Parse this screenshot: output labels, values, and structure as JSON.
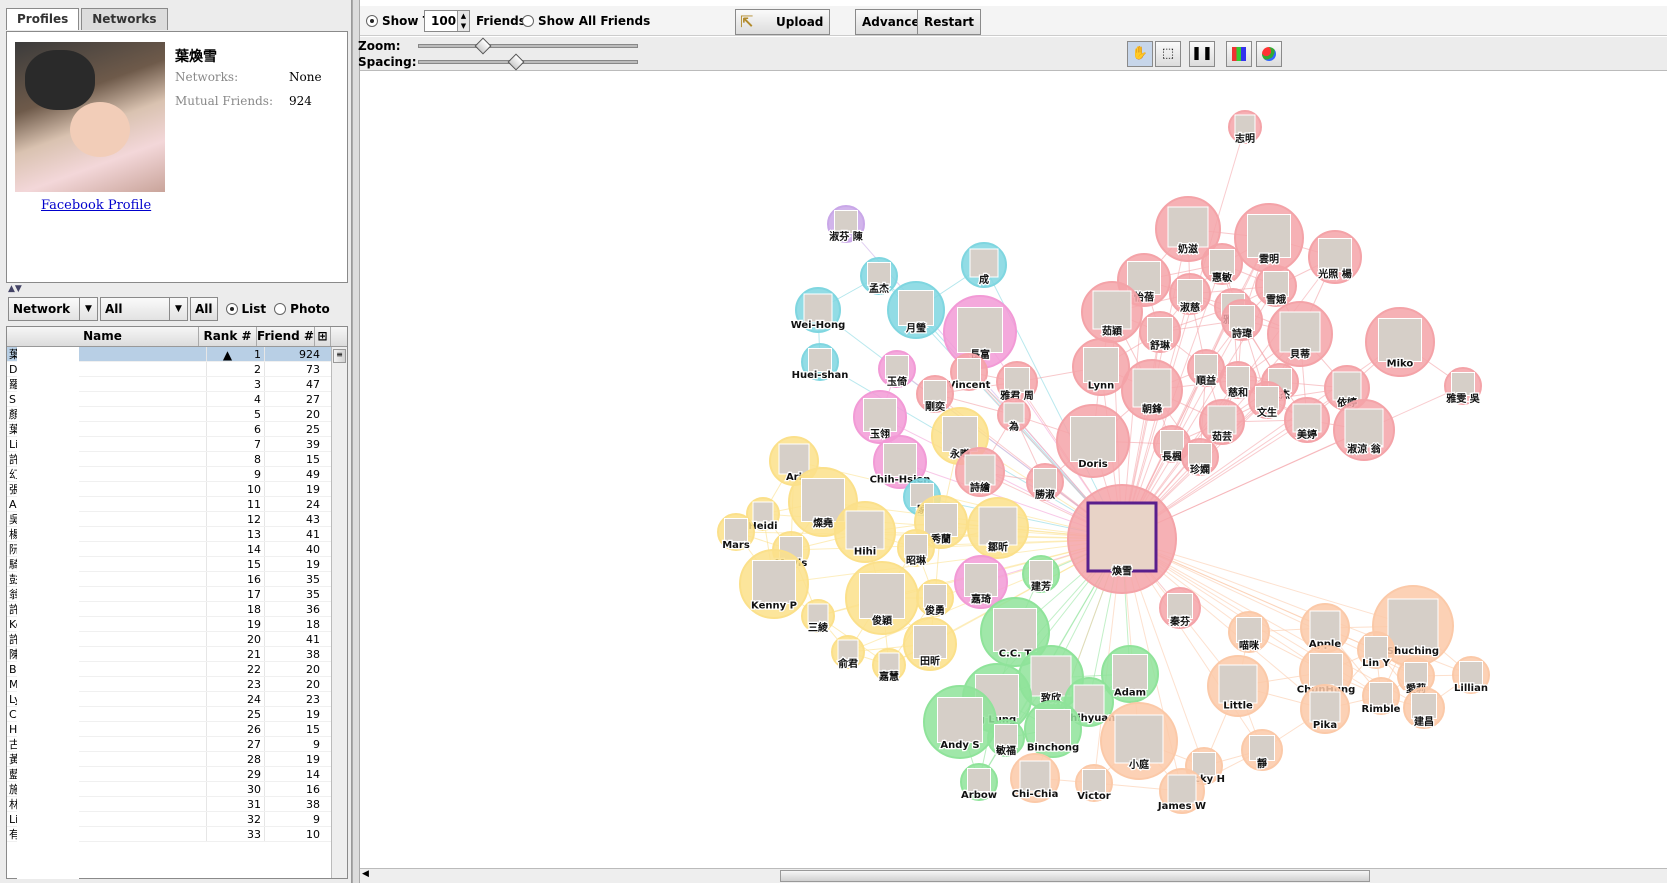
{
  "tabs": [
    "Profiles",
    "Networks"
  ],
  "profile": {
    "name": "葉煥雪",
    "networks_label": "Networks:",
    "networks_value": "None",
    "mutual_label": "Mutual Friends:",
    "mutual_value": "924",
    "link": "Facebook Profile"
  },
  "filters": {
    "network": "Network",
    "all_select": "All",
    "all_button": "All",
    "list": "List",
    "photo": "Photo"
  },
  "table": {
    "headers": [
      "Name",
      "Rank #",
      "Friend #"
    ],
    "rows": [
      [
        "葉煥雪",
        "1",
        "924"
      ],
      [
        "Doris Wu",
        "2",
        "73"
      ],
      [
        "羅",
        "3",
        "47"
      ],
      [
        "Sh                i",
        "4",
        "27"
      ],
      [
        "顏",
        "5",
        "20"
      ],
      [
        "葉",
        "6",
        "25"
      ],
      [
        "Lit",
        "7",
        "39"
      ],
      [
        "許",
        "8",
        "15"
      ],
      [
        "幻",
        "9",
        "49"
      ],
      [
        "張",
        "10",
        "19"
      ],
      [
        "An",
        "11",
        "24"
      ],
      [
        "吳",
        "12",
        "43"
      ],
      [
        "楊",
        "13",
        "41"
      ],
      [
        "阮",
        "14",
        "40"
      ],
      [
        "騎",
        "15",
        "19"
      ],
      [
        "彭",
        "16",
        "35"
      ],
      [
        "翁",
        "17",
        "35"
      ],
      [
        "許",
        "18",
        "36"
      ],
      [
        "Ke",
        "19",
        "18"
      ],
      [
        "許",
        "20",
        "41"
      ],
      [
        "陳",
        "21",
        "38"
      ],
      [
        "Bi",
        "22",
        "20"
      ],
      [
        "Mi                eng",
        "23",
        "20"
      ],
      [
        "Ly",
        "24",
        "23"
      ],
      [
        "C.",
        "25",
        "19"
      ],
      [
        "Hi",
        "26",
        "15"
      ],
      [
        "古",
        "27",
        "9"
      ],
      [
        "黃",
        "28",
        "19"
      ],
      [
        "藍",
        "29",
        "14"
      ],
      [
        "施",
        "30",
        "16"
      ],
      [
        "林",
        "31",
        "38"
      ],
      [
        "Lit               en",
        "32",
        "9"
      ],
      [
        "有",
        "33",
        "10"
      ]
    ]
  },
  "toolbar": {
    "show_top": "Show Top",
    "top_value": "100",
    "friends": "Friends",
    "show_all": "Show All Friends",
    "upload": "Upload",
    "advanced": "Advanced",
    "restart": "Restart",
    "zoom": "Zoom:",
    "spacing": "Spacing:"
  },
  "graph": {
    "center": "煥雪",
    "nodes": [
      {
        "label": "志明",
        "color": "#f4a3a8"
      },
      {
        "label": "淑芬 陳",
        "color": "#c9a7e8"
      },
      {
        "label": "奶滋",
        "color": "#f4a3a8"
      },
      {
        "label": "雲明",
        "color": "#f4a3a8"
      },
      {
        "label": "光照 楊",
        "color": "#f4a3a8"
      },
      {
        "label": "成",
        "color": "#7fd6e0"
      },
      {
        "label": "孟杰",
        "color": "#7fd6e0"
      },
      {
        "label": "Wei-Hong",
        "color": "#7fd6e0"
      },
      {
        "label": "月瑩",
        "color": "#7fd6e0"
      },
      {
        "label": "長富",
        "color": "#f29ad6"
      },
      {
        "label": "怡蓓",
        "color": "#f4a3a8"
      },
      {
        "label": "惠敏",
        "color": "#f4a3a8"
      },
      {
        "label": "雪娥",
        "color": "#f4a3a8"
      },
      {
        "label": "雅芸",
        "color": "#f4a3a8"
      },
      {
        "label": "淑慈",
        "color": "#f4a3a8"
      },
      {
        "label": "詩瑋",
        "color": "#f4a3a8"
      },
      {
        "label": "茹穎",
        "color": "#f4a3a8"
      },
      {
        "label": "舒琳",
        "color": "#f4a3a8"
      },
      {
        "label": "貝蒂",
        "color": "#f4a3a8"
      },
      {
        "label": "Miko",
        "color": "#f4a3a8"
      },
      {
        "label": "Huei-shan",
        "color": "#7fd6e0"
      },
      {
        "label": "玉倚",
        "color": "#f29ad6"
      },
      {
        "label": "Vincent",
        "color": "#f4a3a8"
      },
      {
        "label": "雅君 周",
        "color": "#f4a3a8"
      },
      {
        "label": "Lynn",
        "color": "#f4a3a8"
      },
      {
        "label": "順益",
        "color": "#f4a3a8"
      },
      {
        "label": "慈和",
        "color": "#f4a3a8"
      },
      {
        "label": "仁杰",
        "color": "#f4a3a8"
      },
      {
        "label": "依婷",
        "color": "#f4a3a8"
      },
      {
        "label": "雅雯 吳",
        "color": "#f4a3a8"
      },
      {
        "label": "剛奕",
        "color": "#f4a3a8"
      },
      {
        "label": "朝鋒",
        "color": "#f4a3a8"
      },
      {
        "label": "文生",
        "color": "#f4a3a8"
      },
      {
        "label": "美婷",
        "color": "#f4a3a8"
      },
      {
        "label": "玉翎",
        "color": "#f29ad6"
      },
      {
        "label": "為",
        "color": "#f4a3a8"
      },
      {
        "label": "茹芸",
        "color": "#f4a3a8"
      },
      {
        "label": "淑涼 翁",
        "color": "#f4a3a8"
      },
      {
        "label": "永曦",
        "color": "#fbe08a"
      },
      {
        "label": "Doris",
        "color": "#f4a3a8"
      },
      {
        "label": "長楓",
        "color": "#f4a3a8"
      },
      {
        "label": "珍嫻",
        "color": "#f4a3a8"
      },
      {
        "label": "Ari",
        "color": "#fbe08a"
      },
      {
        "label": "Chih-Hsien",
        "color": "#f29ad6"
      },
      {
        "label": "詩繪",
        "color": "#f4a3a8"
      },
      {
        "label": "勝淑",
        "color": "#f4a3a8"
      },
      {
        "label": "家",
        "color": "#7fd6e0"
      },
      {
        "label": "Heidi",
        "color": "#fbe08a"
      },
      {
        "label": "燦堯",
        "color": "#fbe08a"
      },
      {
        "label": "Mars",
        "color": "#fbe08a"
      },
      {
        "label": "秀蘭",
        "color": "#fbe08a"
      },
      {
        "label": "鄒昕",
        "color": "#fbe08a"
      },
      {
        "label": "Hihi",
        "color": "#fbe08a"
      },
      {
        "label": "Mavis",
        "color": "#fbe08a"
      },
      {
        "label": "昭琳",
        "color": "#fbe08a"
      },
      {
        "label": "嘉琦",
        "color": "#f29ad6"
      },
      {
        "label": "建芳",
        "color": "#8fe39a"
      },
      {
        "label": "Kenny P",
        "color": "#fbe08a"
      },
      {
        "label": "俊穎",
        "color": "#fbe08a"
      },
      {
        "label": "俊勇",
        "color": "#fbe08a"
      },
      {
        "label": "秦芬",
        "color": "#f4a3a8"
      },
      {
        "label": "喵咪",
        "color": "#fbc9a8"
      },
      {
        "label": "Apple",
        "color": "#fbc9a8"
      },
      {
        "label": "Shuching",
        "color": "#fbc9a8"
      },
      {
        "label": "三綾",
        "color": "#fbe08a"
      },
      {
        "label": "C.C. T",
        "color": "#8fe39a"
      },
      {
        "label": "俞君",
        "color": "#fbe08a"
      },
      {
        "label": "田昕",
        "color": "#fbe08a"
      },
      {
        "label": "Lin Y",
        "color": "#fbc9a8"
      },
      {
        "label": "ChunHung",
        "color": "#fbc9a8"
      },
      {
        "label": "嘉慧",
        "color": "#fbe08a"
      },
      {
        "label": "致欣",
        "color": "#8fe39a"
      },
      {
        "label": "Adam",
        "color": "#8fe39a"
      },
      {
        "label": "愛莉",
        "color": "#fbc9a8"
      },
      {
        "label": "Lillian",
        "color": "#fbc9a8"
      },
      {
        "label": "g Lung",
        "color": "#8fe39a"
      },
      {
        "label": "Chihyuan",
        "color": "#8fe39a"
      },
      {
        "label": "Little",
        "color": "#fbc9a8"
      },
      {
        "label": "Rimble",
        "color": "#fbc9a8"
      },
      {
        "label": "Pika",
        "color": "#fbc9a8"
      },
      {
        "label": "建昌",
        "color": "#fbc9a8"
      },
      {
        "label": "Andy S",
        "color": "#8fe39a"
      },
      {
        "label": "敏福",
        "color": "#8fe39a"
      },
      {
        "label": "Binchong",
        "color": "#8fe39a"
      },
      {
        "label": "小庭",
        "color": "#fbc9a8"
      },
      {
        "label": "靜",
        "color": "#fbc9a8"
      },
      {
        "label": "Chi-Chia",
        "color": "#fbc9a8"
      },
      {
        "label": "Ricky H",
        "color": "#fbc9a8"
      },
      {
        "label": "Arbow",
        "color": "#8fe39a"
      },
      {
        "label": "Victor",
        "color": "#fbc9a8"
      },
      {
        "label": "James W",
        "color": "#fbc9a8"
      }
    ]
  }
}
